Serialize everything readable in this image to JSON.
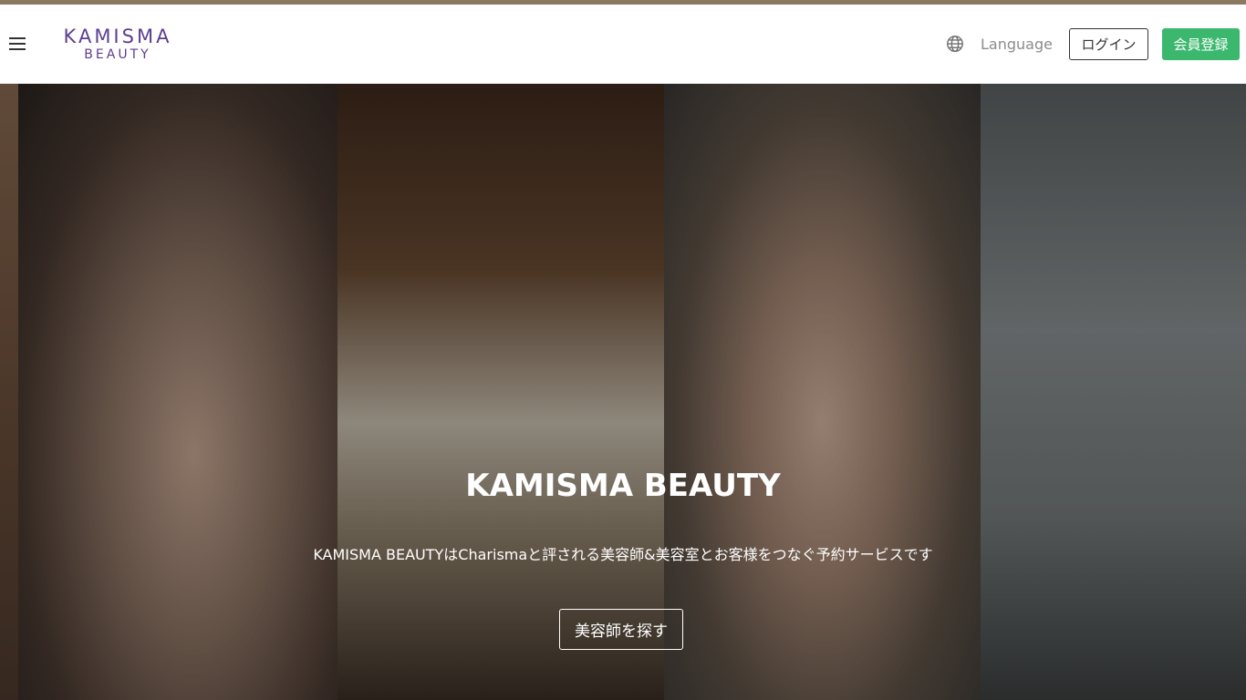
{
  "brand": {
    "logo_main": "KAMISMA",
    "logo_sub": "BEAUTY",
    "logo_color": "#5c3f8f",
    "top_accent_color": "#8a7a62"
  },
  "header": {
    "menu_icon": "hamburger-menu-icon",
    "language_icon": "globe-icon",
    "language_label": "Language",
    "login_label": "ログイン",
    "signup_label": "会員登録",
    "signup_color": "#3bb86e"
  },
  "hero": {
    "title": "KAMISMA BEAUTY",
    "subtitle": "KAMISMA BEAUTYはCharismaと評される美容師&美容室とお客様をつなぐ予約サービスです",
    "cta_label": "美容師を探す"
  }
}
